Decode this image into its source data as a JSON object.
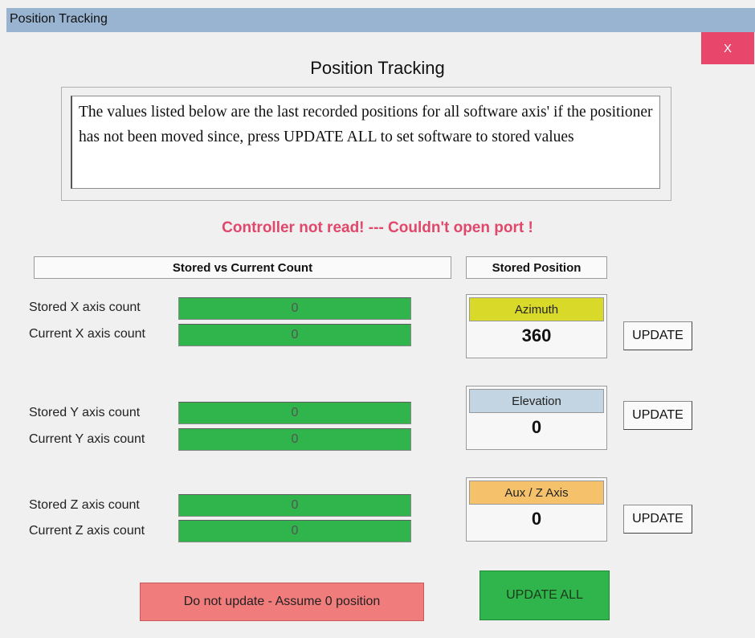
{
  "window": {
    "title": "Position Tracking",
    "close_label": "X"
  },
  "header": "Position Tracking",
  "notice": "The values listed below are the last recorded positions for all software axis'  if the positioner has not been moved since, press UPDATE ALL to set software to stored  values",
  "status": "Controller not read! --- Couldn't open port !",
  "columns": {
    "counts": "Stored vs Current Count",
    "stored_position": "Stored Position"
  },
  "axes": [
    {
      "stored_label": "Stored X axis count",
      "stored_value": "0",
      "current_label": "Current X axis count",
      "current_value": "0"
    },
    {
      "stored_label": "Stored Y axis count",
      "stored_value": "0",
      "current_label": "Current Y axis count",
      "current_value": "0"
    },
    {
      "stored_label": "Stored Z axis count",
      "stored_value": "0",
      "current_label": "Current Z axis count",
      "current_value": "0"
    }
  ],
  "positions": [
    {
      "caption": "Azimuth",
      "value": "360",
      "caption_color": "#d9d92a"
    },
    {
      "caption": "Elevation",
      "value": "0",
      "caption_color": "#c3d5e2"
    },
    {
      "caption": "Aux / Z Axis",
      "value": "0",
      "caption_color": "#f5c26b"
    }
  ],
  "update_label": "UPDATE",
  "buttons": {
    "no_update": "Do not update - Assume 0 position",
    "update_all": "UPDATE ALL"
  },
  "colors": {
    "field_green": "#2fb54b",
    "status_red": "#e0476a",
    "close_red": "#e8466a",
    "no_update_red": "#f07c7c"
  }
}
